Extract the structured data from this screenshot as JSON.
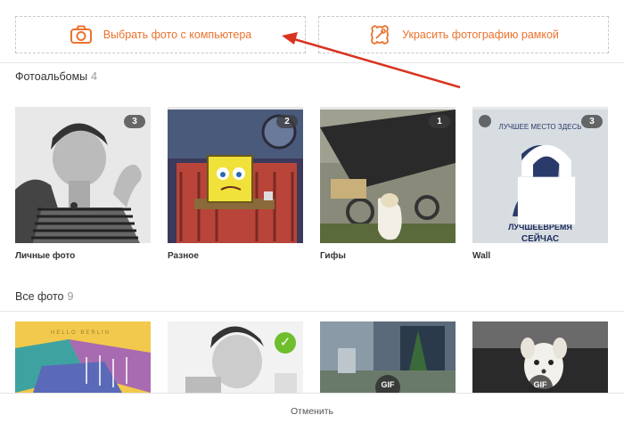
{
  "actions": {
    "upload_label": "Выбрать фото с компьютера",
    "frame_label": "Украсить фотографию рамкой"
  },
  "albums_section": {
    "title": "Фотоальбомы",
    "count": "4",
    "items": [
      {
        "name": "Личные фото",
        "count": "3",
        "locked": false
      },
      {
        "name": "Разное",
        "count": "2",
        "locked": false
      },
      {
        "name": "Гифы",
        "count": "1",
        "locked": false
      },
      {
        "name": "Wall",
        "count": "3",
        "locked": true
      }
    ]
  },
  "all_photos_section": {
    "title": "Все фото",
    "count": "9",
    "photo_badges": {
      "selected": "✓",
      "gif": "GIF"
    }
  },
  "wall_poster_text": {
    "top": "ЛУЧШЕЕ МЕСТО ЗДЕСЬ",
    "line1": "ЛУЧШЕЕВРЕМЯ",
    "line2": "СЕЙЧАС"
  },
  "photo1_text": "HELLO BERLIN",
  "footer": {
    "cancel_label": "Отменить"
  },
  "colors": {
    "accent": "#eb722e",
    "arrow": "#d9331f",
    "selected": "#6fbe2e"
  }
}
